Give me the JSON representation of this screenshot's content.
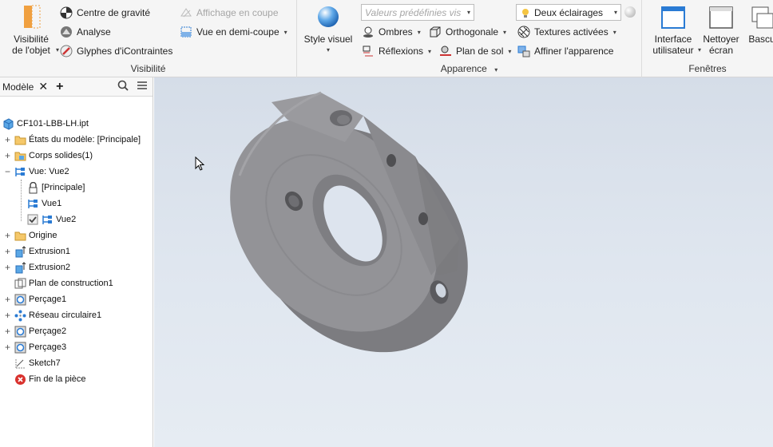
{
  "ribbon": {
    "visibility": {
      "title": "Visibilité",
      "big_button": "Visibilité\nde l'objet",
      "centre_gravite": "Centre de gravité",
      "analyse": "Analyse",
      "glyphes": "Glyphes d'iContraintes",
      "affichage_coupe": "Affichage en coupe",
      "vue_demi_coupe": "Vue en demi-coupe"
    },
    "appearance": {
      "title": "Apparence",
      "style_visuel": "Style visuel",
      "preset_placeholder": "Valeurs prédéfinies vis",
      "ombres": "Ombres",
      "reflexions": "Réflexions",
      "orthogonale": "Orthogonale",
      "plan_de_sol": "Plan de sol",
      "deux_eclairages": "Deux éclairages",
      "textures": "Textures activées",
      "affiner": "Affiner l'apparence"
    },
    "windows": {
      "title": "Fenêtres",
      "interface": "Interface\nutilisateur",
      "nettoyer": "Nettoyer\nécran",
      "basculer": "Bascu"
    }
  },
  "browser": {
    "tab": "Modèle",
    "tree": [
      {
        "label": "CF101-LBB-LH.ipt",
        "icon": "part-icon"
      },
      {
        "label": "États du modèle: [Principale]",
        "icon": "folder-icon"
      },
      {
        "label": "Corps solides(1)",
        "icon": "folder-icon"
      },
      {
        "label": "Vue: Vue2",
        "icon": "view-icon"
      },
      {
        "label": "[Principale]",
        "icon": "lock-icon"
      },
      {
        "label": "Vue1",
        "icon": "view-icon"
      },
      {
        "label": "Vue2",
        "icon": "view-icon"
      },
      {
        "label": "Origine",
        "icon": "folder-icon"
      },
      {
        "label": "Extrusion1",
        "icon": "extrusion-icon"
      },
      {
        "label": "Extrusion2",
        "icon": "extrusion-icon"
      },
      {
        "label": "Plan de construction1",
        "icon": "plane-icon"
      },
      {
        "label": "Perçage1",
        "icon": "hole-icon"
      },
      {
        "label": "Réseau circulaire1",
        "icon": "pattern-icon"
      },
      {
        "label": "Perçage2",
        "icon": "hole-icon"
      },
      {
        "label": "Perçage3",
        "icon": "hole-icon"
      },
      {
        "label": "Sketch7",
        "icon": "sketch-icon"
      },
      {
        "label": "Fin de la pièce",
        "icon": "end-icon"
      }
    ]
  },
  "colors": {
    "accent": "#2a7bd4",
    "part_gray": "#8f8f93",
    "viewport_top": "#d5dde8",
    "viewport_bottom": "#e6ecf3",
    "end_red": "#d9322e"
  }
}
